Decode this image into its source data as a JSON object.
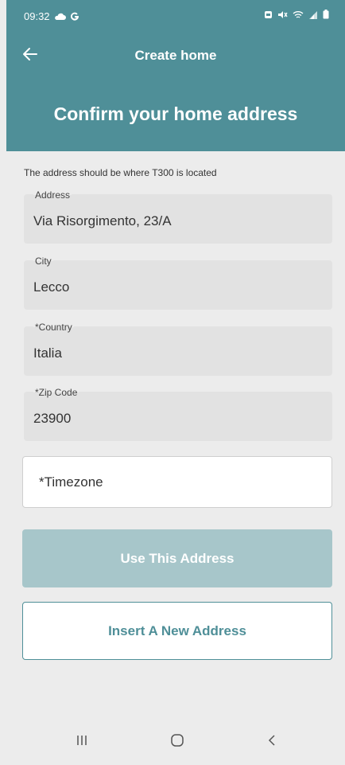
{
  "status": {
    "time": "09:32",
    "left_icons": [
      "cloud-icon",
      "g-icon"
    ],
    "right_icons": [
      "battery-saver-icon",
      "mute-icon",
      "wifi-icon",
      "signal-icon",
      "battery-icon"
    ]
  },
  "appbar": {
    "title": "Create home"
  },
  "hero": {
    "title": "Confirm your home address"
  },
  "form": {
    "hint": "The address should be where T300 is located",
    "fields": [
      {
        "label": "Address",
        "value": "Via Risorgimento, 23/A"
      },
      {
        "label": "City",
        "value": "Lecco"
      },
      {
        "label": "*Country",
        "value": "Italia"
      },
      {
        "label": "*Zip Code",
        "value": "23900"
      }
    ],
    "timezone_placeholder": "*Timezone"
  },
  "buttons": {
    "use_address": "Use This Address",
    "insert_new": "Insert A New Address"
  },
  "colors": {
    "primary": "#4f8f98",
    "primary_disabled": "#a7c6ca",
    "background": "#ececec",
    "field_fill": "#e2e2e2"
  }
}
